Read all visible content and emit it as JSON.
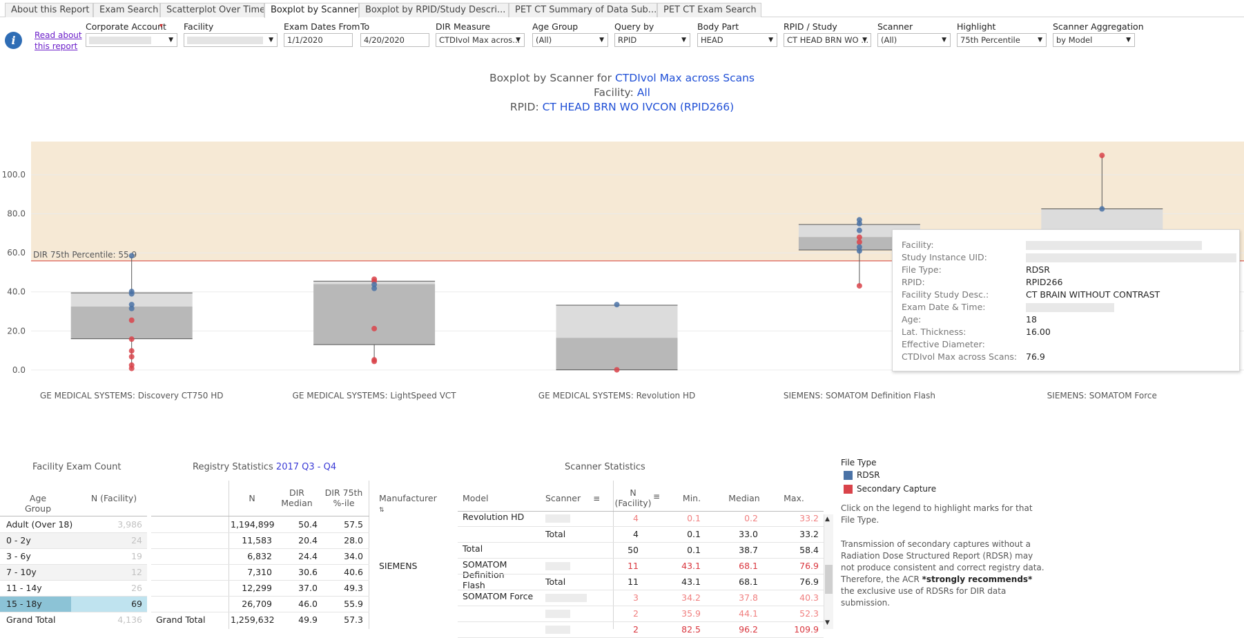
{
  "tabs": [
    "About this Report",
    "Exam Search",
    "Scatterplot Over Time",
    "Boxplot by Scanner",
    "Boxplot by RPID/Study Descri...",
    "PET CT Summary of Data Sub...",
    "PET CT Exam Search"
  ],
  "active_tab": "Boxplot by Scanner",
  "read_about": "Read about this report",
  "filters": {
    "corporate_account": {
      "label": "Corporate Account",
      "value": ""
    },
    "facility": {
      "label": "Facility",
      "value": ""
    },
    "exam_dates_from": {
      "label": "Exam Dates From",
      "value": "1/1/2020"
    },
    "to": {
      "label": "To",
      "value": "4/20/2020"
    },
    "dir_measure": {
      "label": "DIR Measure",
      "value": "CTDIvol Max acros..."
    },
    "age_group": {
      "label": "Age Group",
      "value": "(All)"
    },
    "query_by": {
      "label": "Query by",
      "value": "RPID"
    },
    "body_part": {
      "label": "Body Part",
      "value": "HEAD"
    },
    "rpid_study": {
      "label": "RPID / Study",
      "value": "CT HEAD BRN WO ..."
    },
    "scanner": {
      "label": "Scanner",
      "value": "(All)"
    },
    "highlight": {
      "label": "Highlight",
      "value": "75th Percentile"
    },
    "scanner_aggregation": {
      "label": "Scanner Aggregation",
      "value": "by Model"
    }
  },
  "title": {
    "line1_prefix": "Boxplot by Scanner for ",
    "line1_value": "CTDIvol Max across Scans",
    "line2_prefix": "Facility: ",
    "line2_value": "All",
    "line3_prefix": "RPID: ",
    "line3_value": "CT HEAD BRN WO IVCON (RPID266)"
  },
  "colors": {
    "rdsr": "#4a72a6",
    "secondary": "#d9434a",
    "ref_band": "#f6e9d5",
    "ref_line": "#e07a6f",
    "box_upper": "#dcdcdc",
    "box_lower": "#b8b8b8"
  },
  "chart_data": {
    "type": "box",
    "ylim": [
      -5,
      117
    ],
    "yticks": [
      "0.0",
      "20.0",
      "40.0",
      "60.0",
      "80.0",
      "100.0"
    ],
    "reference_line": {
      "label": "DIR 75th Percentile: 55.9",
      "value": 55.9
    },
    "categories": [
      "GE MEDICAL SYSTEMS: Discovery CT750 HD",
      "GE MEDICAL SYSTEMS: LightSpeed VCT",
      "GE MEDICAL SYSTEMS: Revolution HD",
      "SIEMENS: SOMATOM Definition Flash",
      "SIEMENS: SOMATOM Force"
    ],
    "boxes": [
      {
        "min": 0.5,
        "q1": 16,
        "median": 32.5,
        "q3": 39.5,
        "max": 58
      },
      {
        "min": 4.5,
        "q1": 13,
        "median": 44,
        "q3": 45.5,
        "max": 46
      },
      {
        "min": 0.1,
        "q1": 0.1,
        "median": 16.5,
        "q3": 33.2,
        "max": 33.2
      },
      {
        "min": 43.1,
        "q1": 61.5,
        "median": 68.1,
        "q3": 74.5,
        "max": 76.9
      },
      {
        "min": 34.2,
        "q1": 34.2,
        "median": 50,
        "q3": 82.5,
        "max": 109.9
      }
    ],
    "points": [
      [
        {
          "y": 58.5,
          "t": "rdsr"
        },
        {
          "y": 40.2,
          "t": "rdsr"
        },
        {
          "y": 39.0,
          "t": "rdsr"
        },
        {
          "y": 33.5,
          "t": "rdsr"
        },
        {
          "y": 31.5,
          "t": "rdsr"
        },
        {
          "y": 25.5,
          "t": "sc"
        },
        {
          "y": 15.8,
          "t": "sc"
        },
        {
          "y": 9.8,
          "t": "sc"
        },
        {
          "y": 6.8,
          "t": "sc"
        },
        {
          "y": 2.5,
          "t": "sc"
        },
        {
          "y": 0.8,
          "t": "sc"
        }
      ],
      [
        {
          "y": 46.5,
          "t": "sc"
        },
        {
          "y": 45.5,
          "t": "sc"
        },
        {
          "y": 43.8,
          "t": "rdsr"
        },
        {
          "y": 41.8,
          "t": "rdsr"
        },
        {
          "y": 21.2,
          "t": "sc"
        },
        {
          "y": 5.2,
          "t": "sc"
        },
        {
          "y": 4.4,
          "t": "sc"
        }
      ],
      [
        {
          "y": 33.5,
          "t": "rdsr"
        },
        {
          "y": 0.1,
          "t": "sc"
        }
      ],
      [
        {
          "y": 76.9,
          "t": "rdsr"
        },
        {
          "y": 75.0,
          "t": "rdsr"
        },
        {
          "y": 71.5,
          "t": "rdsr"
        },
        {
          "y": 68.0,
          "t": "sc"
        },
        {
          "y": 65.5,
          "t": "sc"
        },
        {
          "y": 63.0,
          "t": "rdsr"
        },
        {
          "y": 61.0,
          "t": "rdsr"
        },
        {
          "y": 43.1,
          "t": "sc"
        }
      ],
      [
        {
          "y": 109.9,
          "t": "sc"
        },
        {
          "y": 82.5,
          "t": "rdsr"
        }
      ]
    ]
  },
  "tooltip": {
    "rows": [
      {
        "k": "Facility:",
        "v": ""
      },
      {
        "k": "Study Instance UID:",
        "v": ""
      },
      {
        "k": "File Type:",
        "v": "RDSR"
      },
      {
        "k": "RPID:",
        "v": "RPID266"
      },
      {
        "k": "Facility Study Desc.:",
        "v": "CT BRAIN WITHOUT CONTRAST"
      },
      {
        "k": "Exam Date & Time:",
        "v": ""
      },
      {
        "k": "Age:",
        "v": "18"
      },
      {
        "k": "Lat. Thickness:",
        "v": "16.00"
      },
      {
        "k": "Effective Diameter:",
        "v": ""
      },
      {
        "k": "CTDIvol Max across Scans:",
        "v": "76.9"
      }
    ]
  },
  "facility_exam_count": {
    "title": "Facility Exam Count",
    "col_age": "Age Group",
    "col_n": "N (Facility)",
    "rows": [
      {
        "age": "Adult (Over 18)",
        "n": "3,986"
      },
      {
        "age": "0 - 2y",
        "n": "24"
      },
      {
        "age": "3 - 6y",
        "n": "19"
      },
      {
        "age": "7 - 10y",
        "n": "12"
      },
      {
        "age": "11 - 14y",
        "n": "26"
      },
      {
        "age": "15 - 18y",
        "n": "69"
      }
    ],
    "grand_total_label": "Grand Total",
    "grand_total": "4,136"
  },
  "registry_stats": {
    "title_prefix": "Registry Statistics ",
    "title_period": "2017 Q3 - Q4",
    "col_n": "N",
    "col_median": "DIR Median",
    "col_p75": "DIR 75th %-ile",
    "rows": [
      {
        "n": "1,194,899",
        "median": "50.4",
        "p75": "57.5"
      },
      {
        "n": "11,583",
        "median": "20.4",
        "p75": "28.0"
      },
      {
        "n": "6,832",
        "median": "24.4",
        "p75": "34.0"
      },
      {
        "n": "7,310",
        "median": "30.6",
        "p75": "40.6"
      },
      {
        "n": "12,299",
        "median": "37.0",
        "p75": "49.3"
      },
      {
        "n": "26,709",
        "median": "46.0",
        "p75": "55.9"
      }
    ],
    "grand_total_label": "Grand Total",
    "grand_total": {
      "n": "1,259,632",
      "median": "49.9",
      "p75": "57.3"
    }
  },
  "scanner_stats": {
    "title": "Scanner Statistics",
    "col_manufacturer": "Manufacturer",
    "col_model": "Model",
    "col_scanner": "Scanner",
    "col_n": "N (Facility)",
    "col_min": "Min.",
    "col_median": "Median",
    "col_max": "Max.",
    "manufacturer_siemens": "SIEMENS",
    "rows": [
      {
        "model": "Revolution HD",
        "scanner": "",
        "n": "4",
        "min": "0.1",
        "median": "0.2",
        "max": "33.2",
        "style": "lightred"
      },
      {
        "model": "",
        "scanner": "Total",
        "n": "4",
        "min": "0.1",
        "median": "33.0",
        "max": "33.2",
        "style": ""
      },
      {
        "model": "Total",
        "scanner": "",
        "n": "50",
        "min": "0.1",
        "median": "38.7",
        "max": "58.4",
        "style": ""
      },
      {
        "model": "SOMATOM Definition Flash",
        "scanner": "",
        "n": "11",
        "min": "43.1",
        "median": "68.1",
        "max": "76.9",
        "style": "red"
      },
      {
        "model": "",
        "scanner": "Total",
        "n": "11",
        "min": "43.1",
        "median": "68.1",
        "max": "76.9",
        "style": ""
      },
      {
        "model": "SOMATOM Force",
        "scanner": "",
        "n": "3",
        "min": "34.2",
        "median": "37.8",
        "max": "40.3",
        "style": "lightred"
      },
      {
        "model": "",
        "scanner": "",
        "n": "2",
        "min": "35.9",
        "median": "44.1",
        "max": "52.3",
        "style": "lightred"
      },
      {
        "model": "",
        "scanner": "",
        "n": "2",
        "min": "82.5",
        "median": "96.2",
        "max": "109.9",
        "style": "red"
      }
    ]
  },
  "legend": {
    "title": "File Type",
    "items": [
      {
        "label": "RDSR",
        "color": "#4a72a6"
      },
      {
        "label": "Secondary Capture",
        "color": "#d9434a"
      }
    ],
    "note1": "Click on the legend to highlight marks for that File Type.",
    "note2a": "Transmission of secondary captures without a Radiation Dose Structured Report (RDSR) may not produce consistent and correct registry data. Therefore, the ACR ",
    "note2b": "*strongly recommends*",
    "note2c": " the exclusive use of RDSRs for DIR data submission."
  }
}
